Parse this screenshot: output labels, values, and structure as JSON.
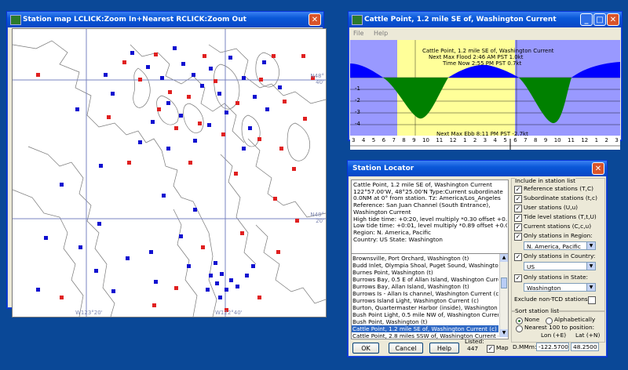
{
  "map_window": {
    "title": "Station map LCLICK:Zoom In+Nearest  RCLICK:Zoom Out",
    "labels": {
      "n48_40": "N48°\n40'",
      "n48_20": "N48°\n20'",
      "w123_20": "W123°20'",
      "w122_40": "W122°40'"
    },
    "marker_colors": {
      "reference": "#e02020",
      "subordinate": "#1010d0"
    }
  },
  "tide_window": {
    "title": "Cattle Point, 1.2 mile SE of, Washington Current",
    "menu": [
      "File",
      "Help"
    ],
    "lines": [
      "Cattle Point, 1.2 mile SE of, Washington Current",
      "Next Max Flood 2:46 AM PST 1.0kt",
      "Time Now 2:55 PM PST 0.7kt"
    ],
    "ebb_line": "Next Max Ebb 8:11 PM PST -2.7kt",
    "y_ticks": [
      "-1",
      "-2",
      "-3",
      "-4"
    ],
    "hours": [
      "3",
      "4",
      "5",
      "6",
      "7",
      "8",
      "9",
      "10",
      "11",
      "12",
      "1",
      "2",
      "3",
      "4",
      "5",
      "6",
      "7",
      "8",
      "9",
      "10",
      "11",
      "12",
      "1",
      "2",
      "3"
    ],
    "colors": {
      "flood": "#0000ff",
      "ebb": "#008000",
      "day": "#ffff99",
      "night": "#9999ff"
    }
  },
  "locator": {
    "title": "Station Locator",
    "info_lines": [
      "Cattle Point, 1.2 mile SE of, Washington Current",
      "122°57.00'W, 48°25.00'N  Type:Current subordinate",
      "0.0NM at 0° from station.  Tz: America/Los_Angeles",
      "Reference: San Juan Channel (South Entrance),",
      "Washington Current",
      "High tide time: +0:20,  level multiply *0.30 offset +0.0",
      "Low tide time: +0:01,  level multiply *0.89 offset +0.0",
      "Region: N. America, Pacific",
      "Country: US      State: Washington"
    ],
    "stations": [
      "Brownsville, Port Orchard, Washington (t)",
      "Budd Inlet, Olympia Shoal, Puget Sound, Washington (t)",
      "Burnes Point, Washington (t)",
      "Burrows Bay, 0.5 E of Allan Island, Washington Current",
      "Burrows Bay, Allan Island, Washington (t)",
      "Burrows Is - Allan Is channel, Washington Current (c)",
      "Burrows Island Light, Washington Current (c)",
      "Burton, Quartermaster Harbor (inside), Washington (t)",
      "Bush Point Light, 0.5 mile NW of, Washington Current (c)",
      "Bush Point, Washington (t)",
      "Cattle Point, 1.2 mile SE of, Washington Current (c)",
      "Cattle Point, 2.8 miles SSW of, Washington Current (c)"
    ],
    "selected_index": 10,
    "include_title": "Include in station list",
    "checks": [
      {
        "label": "Reference stations (T,C)",
        "checked": true
      },
      {
        "label": "Subordinate stations (t,c)",
        "checked": true
      },
      {
        "label": "User stations (U,u)",
        "checked": true
      },
      {
        "label": "Tide level stations (T,t,U)",
        "checked": true
      },
      {
        "label": "Current stations (C,c,u)",
        "checked": true
      },
      {
        "label": "Only stations in Region:",
        "checked": true
      }
    ],
    "region_value": "N. America, Pacific",
    "country_label": "Only stations in Country:",
    "country_value": "US",
    "state_label": "Only stations in State:",
    "state_value": "Washington",
    "exclude_label": "Exclude non-TCD stations",
    "sort_title": "Sort station list",
    "sort_none": "None",
    "sort_alpha": "Alphabetically",
    "nearest_label": "Nearest 100 to position:",
    "lon_label": "Lon (+E)",
    "lat_label": "Lat (+N)",
    "dmm_label": "D.MMm:",
    "lon_value": "-122.5700",
    "lat_value": "48.2500",
    "ok": "OK",
    "cancel": "Cancel",
    "help": "Help",
    "listed_label": "Listed:",
    "listed_count": "447",
    "map_label": "Map",
    "map_checked": true
  }
}
